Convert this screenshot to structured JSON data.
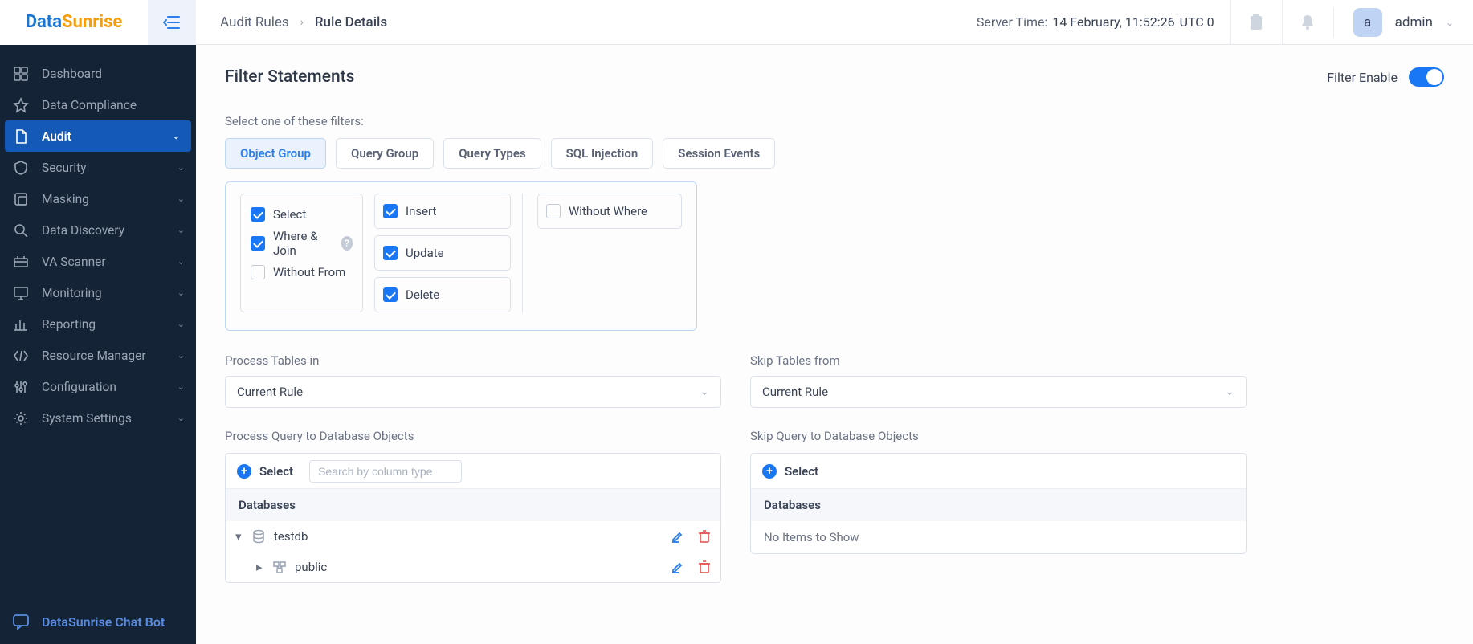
{
  "logo": {
    "part1": "Data",
    "part2": "Sunrise"
  },
  "breadcrumb": {
    "parent": "Audit Rules",
    "sep": "›",
    "current": "Rule Details"
  },
  "server_time": {
    "label": "Server Time:",
    "value": "14 February, 11:52:26",
    "tz": "UTC 0"
  },
  "user": {
    "avatar": "a",
    "name": "admin"
  },
  "sidebar": {
    "items": [
      {
        "label": "Dashboard",
        "expandable": false
      },
      {
        "label": "Data Compliance",
        "expandable": false
      },
      {
        "label": "Audit",
        "expandable": true,
        "active": true
      },
      {
        "label": "Security",
        "expandable": true
      },
      {
        "label": "Masking",
        "expandable": true
      },
      {
        "label": "Data Discovery",
        "expandable": true
      },
      {
        "label": "VA Scanner",
        "expandable": true
      },
      {
        "label": "Monitoring",
        "expandable": true
      },
      {
        "label": "Reporting",
        "expandable": true
      },
      {
        "label": "Resource Manager",
        "expandable": true
      },
      {
        "label": "Configuration",
        "expandable": true
      },
      {
        "label": "System Settings",
        "expandable": true
      }
    ],
    "chatbot": "DataSunrise Chat Bot"
  },
  "section": {
    "title": "Filter Statements",
    "enable_label": "Filter Enable",
    "filters_hint": "Select one of these filters:",
    "tabs": [
      "Object Group",
      "Query Group",
      "Query Types",
      "SQL Injection",
      "Session Events"
    ],
    "active_tab": 0,
    "og": {
      "col1": [
        {
          "label": "Select",
          "checked": true
        },
        {
          "label": "Where & Join",
          "checked": true,
          "help": true
        },
        {
          "label": "Without From",
          "checked": false
        }
      ],
      "col2": [
        {
          "label": "Insert",
          "checked": true
        },
        {
          "label": "Update",
          "checked": true
        },
        {
          "label": "Delete",
          "checked": true
        }
      ],
      "col3": [
        {
          "label": "Without Where",
          "checked": false
        }
      ]
    },
    "process_tables": {
      "label": "Process Tables in",
      "value": "Current Rule"
    },
    "skip_tables": {
      "label": "Skip Tables from",
      "value": "Current Rule"
    },
    "process_query": {
      "label": "Process Query to Database Objects",
      "select": "Select",
      "search_placeholder": "Search by column type",
      "header": "Databases",
      "rows": [
        {
          "level": 0,
          "name": "testdb",
          "icon": "db",
          "expanded": true
        },
        {
          "level": 1,
          "name": "public",
          "icon": "schema",
          "expanded": false
        }
      ]
    },
    "skip_query": {
      "label": "Skip Query to Database Objects",
      "select": "Select",
      "header": "Databases",
      "empty": "No Items to Show"
    }
  }
}
